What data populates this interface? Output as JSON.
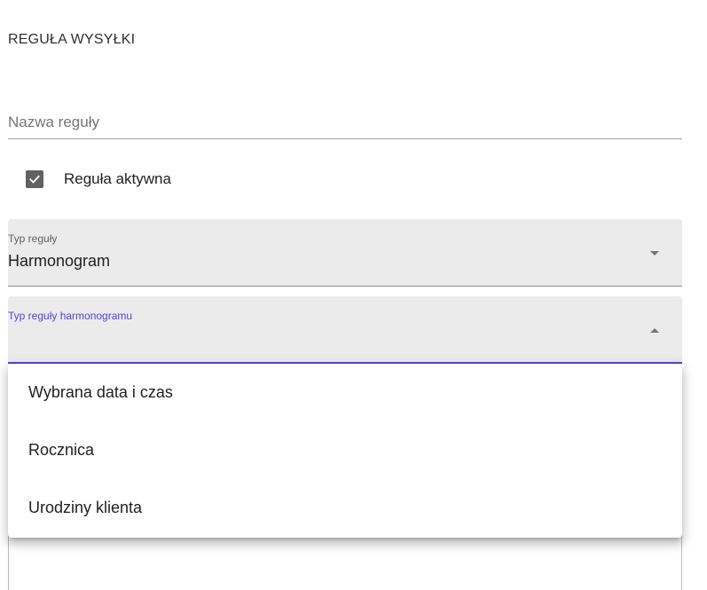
{
  "section": {
    "title": "REGUŁA WYSYŁKI"
  },
  "rule_name": {
    "placeholder": "Nazwa reguły",
    "value": ""
  },
  "active_checkbox": {
    "label": "Reguła aktywna",
    "checked": true
  },
  "rule_type": {
    "label": "Typ reguły",
    "value": "Harmonogram",
    "icon": "chevron-down-icon"
  },
  "schedule_type": {
    "label": "Typ reguły harmonogramu",
    "value": "",
    "icon": "chevron-up-icon",
    "options": [
      "Wybrana data i czas",
      "Rocznica",
      "Urodziny klienta"
    ]
  },
  "colors": {
    "accent": "#5146d6",
    "checkbox_fill": "#616161",
    "field_background": "#ebebeb"
  }
}
